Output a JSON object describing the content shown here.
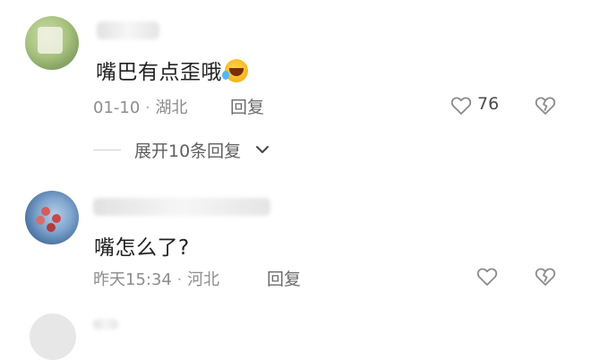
{
  "comments": [
    {
      "text": "嘴巴有点歪哦",
      "emoji": "laughing-with-tears",
      "date": "01-10",
      "location": "湖北",
      "reply": "回复",
      "likes": "76",
      "expand": "展开10条回复"
    },
    {
      "text": "嘴怎么了?",
      "date": "昨天15:34",
      "location": "河北",
      "reply": "回复"
    }
  ],
  "separator": "·",
  "icons": {
    "like": "heart-outline-icon",
    "dislike": "broken-heart-icon",
    "expand": "chevron-down-icon"
  },
  "colors": {
    "text": "#222222",
    "meta": "#8d8d8d",
    "icon": "#8a8a8a"
  }
}
